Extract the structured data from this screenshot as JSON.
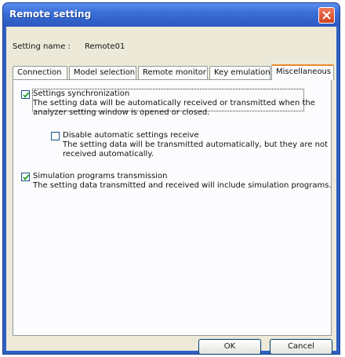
{
  "window": {
    "title": "Remote setting"
  },
  "setting_name": {
    "label": "Setting name :",
    "value": "Remote01"
  },
  "tabs": [
    {
      "label": "Connection",
      "active": false
    },
    {
      "label": "Model selection",
      "active": false
    },
    {
      "label": "Remote monitor",
      "active": false
    },
    {
      "label": "Key emulation",
      "active": false
    },
    {
      "label": "Miscellaneous",
      "active": true
    }
  ],
  "options": {
    "sync": {
      "label": "Settings synchronization",
      "checked": true,
      "description": "The setting data will be automatically received or transmitted when the\nanalyzer setting window is opened or closed."
    },
    "disable_receive": {
      "label": "Disable automatic settings receive",
      "checked": false,
      "description": "The setting data will be transmitted automatically, but they are not\nreceived automatically."
    },
    "sim_programs": {
      "label": "Simulation programs transmission",
      "checked": true,
      "description": "The setting data transmitted and received will include simulation programs."
    }
  },
  "buttons": {
    "ok": "OK",
    "cancel": "Cancel"
  },
  "colors": {
    "titlebar": "#3b6fd8",
    "client": "#ece9d8",
    "active_tab_accent": "#e68b2c"
  }
}
